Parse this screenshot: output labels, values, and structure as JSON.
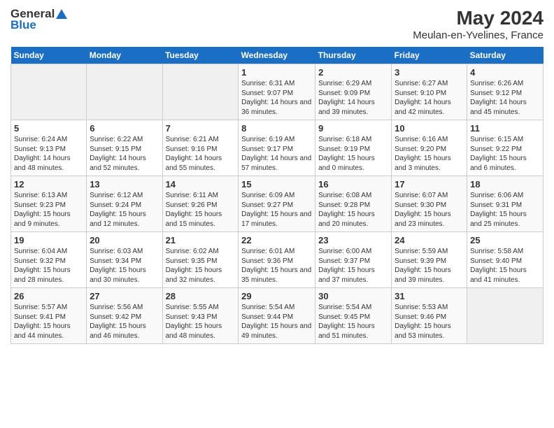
{
  "header": {
    "logo_general": "General",
    "logo_blue": "Blue",
    "title": "May 2024",
    "subtitle": "Meulan-en-Yvelines, France"
  },
  "days_of_week": [
    "Sunday",
    "Monday",
    "Tuesday",
    "Wednesday",
    "Thursday",
    "Friday",
    "Saturday"
  ],
  "weeks": [
    [
      {
        "day": "",
        "sunrise": "",
        "sunset": "",
        "daylight": ""
      },
      {
        "day": "",
        "sunrise": "",
        "sunset": "",
        "daylight": ""
      },
      {
        "day": "",
        "sunrise": "",
        "sunset": "",
        "daylight": ""
      },
      {
        "day": "1",
        "sunrise": "Sunrise: 6:31 AM",
        "sunset": "Sunset: 9:07 PM",
        "daylight": "Daylight: 14 hours and 36 minutes."
      },
      {
        "day": "2",
        "sunrise": "Sunrise: 6:29 AM",
        "sunset": "Sunset: 9:09 PM",
        "daylight": "Daylight: 14 hours and 39 minutes."
      },
      {
        "day": "3",
        "sunrise": "Sunrise: 6:27 AM",
        "sunset": "Sunset: 9:10 PM",
        "daylight": "Daylight: 14 hours and 42 minutes."
      },
      {
        "day": "4",
        "sunrise": "Sunrise: 6:26 AM",
        "sunset": "Sunset: 9:12 PM",
        "daylight": "Daylight: 14 hours and 45 minutes."
      }
    ],
    [
      {
        "day": "5",
        "sunrise": "Sunrise: 6:24 AM",
        "sunset": "Sunset: 9:13 PM",
        "daylight": "Daylight: 14 hours and 48 minutes."
      },
      {
        "day": "6",
        "sunrise": "Sunrise: 6:22 AM",
        "sunset": "Sunset: 9:15 PM",
        "daylight": "Daylight: 14 hours and 52 minutes."
      },
      {
        "day": "7",
        "sunrise": "Sunrise: 6:21 AM",
        "sunset": "Sunset: 9:16 PM",
        "daylight": "Daylight: 14 hours and 55 minutes."
      },
      {
        "day": "8",
        "sunrise": "Sunrise: 6:19 AM",
        "sunset": "Sunset: 9:17 PM",
        "daylight": "Daylight: 14 hours and 57 minutes."
      },
      {
        "day": "9",
        "sunrise": "Sunrise: 6:18 AM",
        "sunset": "Sunset: 9:19 PM",
        "daylight": "Daylight: 15 hours and 0 minutes."
      },
      {
        "day": "10",
        "sunrise": "Sunrise: 6:16 AM",
        "sunset": "Sunset: 9:20 PM",
        "daylight": "Daylight: 15 hours and 3 minutes."
      },
      {
        "day": "11",
        "sunrise": "Sunrise: 6:15 AM",
        "sunset": "Sunset: 9:22 PM",
        "daylight": "Daylight: 15 hours and 6 minutes."
      }
    ],
    [
      {
        "day": "12",
        "sunrise": "Sunrise: 6:13 AM",
        "sunset": "Sunset: 9:23 PM",
        "daylight": "Daylight: 15 hours and 9 minutes."
      },
      {
        "day": "13",
        "sunrise": "Sunrise: 6:12 AM",
        "sunset": "Sunset: 9:24 PM",
        "daylight": "Daylight: 15 hours and 12 minutes."
      },
      {
        "day": "14",
        "sunrise": "Sunrise: 6:11 AM",
        "sunset": "Sunset: 9:26 PM",
        "daylight": "Daylight: 15 hours and 15 minutes."
      },
      {
        "day": "15",
        "sunrise": "Sunrise: 6:09 AM",
        "sunset": "Sunset: 9:27 PM",
        "daylight": "Daylight: 15 hours and 17 minutes."
      },
      {
        "day": "16",
        "sunrise": "Sunrise: 6:08 AM",
        "sunset": "Sunset: 9:28 PM",
        "daylight": "Daylight: 15 hours and 20 minutes."
      },
      {
        "day": "17",
        "sunrise": "Sunrise: 6:07 AM",
        "sunset": "Sunset: 9:30 PM",
        "daylight": "Daylight: 15 hours and 23 minutes."
      },
      {
        "day": "18",
        "sunrise": "Sunrise: 6:06 AM",
        "sunset": "Sunset: 9:31 PM",
        "daylight": "Daylight: 15 hours and 25 minutes."
      }
    ],
    [
      {
        "day": "19",
        "sunrise": "Sunrise: 6:04 AM",
        "sunset": "Sunset: 9:32 PM",
        "daylight": "Daylight: 15 hours and 28 minutes."
      },
      {
        "day": "20",
        "sunrise": "Sunrise: 6:03 AM",
        "sunset": "Sunset: 9:34 PM",
        "daylight": "Daylight: 15 hours and 30 minutes."
      },
      {
        "day": "21",
        "sunrise": "Sunrise: 6:02 AM",
        "sunset": "Sunset: 9:35 PM",
        "daylight": "Daylight: 15 hours and 32 minutes."
      },
      {
        "day": "22",
        "sunrise": "Sunrise: 6:01 AM",
        "sunset": "Sunset: 9:36 PM",
        "daylight": "Daylight: 15 hours and 35 minutes."
      },
      {
        "day": "23",
        "sunrise": "Sunrise: 6:00 AM",
        "sunset": "Sunset: 9:37 PM",
        "daylight": "Daylight: 15 hours and 37 minutes."
      },
      {
        "day": "24",
        "sunrise": "Sunrise: 5:59 AM",
        "sunset": "Sunset: 9:39 PM",
        "daylight": "Daylight: 15 hours and 39 minutes."
      },
      {
        "day": "25",
        "sunrise": "Sunrise: 5:58 AM",
        "sunset": "Sunset: 9:40 PM",
        "daylight": "Daylight: 15 hours and 41 minutes."
      }
    ],
    [
      {
        "day": "26",
        "sunrise": "Sunrise: 5:57 AM",
        "sunset": "Sunset: 9:41 PM",
        "daylight": "Daylight: 15 hours and 44 minutes."
      },
      {
        "day": "27",
        "sunrise": "Sunrise: 5:56 AM",
        "sunset": "Sunset: 9:42 PM",
        "daylight": "Daylight: 15 hours and 46 minutes."
      },
      {
        "day": "28",
        "sunrise": "Sunrise: 5:55 AM",
        "sunset": "Sunset: 9:43 PM",
        "daylight": "Daylight: 15 hours and 48 minutes."
      },
      {
        "day": "29",
        "sunrise": "Sunrise: 5:54 AM",
        "sunset": "Sunset: 9:44 PM",
        "daylight": "Daylight: 15 hours and 49 minutes."
      },
      {
        "day": "30",
        "sunrise": "Sunrise: 5:54 AM",
        "sunset": "Sunset: 9:45 PM",
        "daylight": "Daylight: 15 hours and 51 minutes."
      },
      {
        "day": "31",
        "sunrise": "Sunrise: 5:53 AM",
        "sunset": "Sunset: 9:46 PM",
        "daylight": "Daylight: 15 hours and 53 minutes."
      },
      {
        "day": "",
        "sunrise": "",
        "sunset": "",
        "daylight": ""
      }
    ]
  ]
}
